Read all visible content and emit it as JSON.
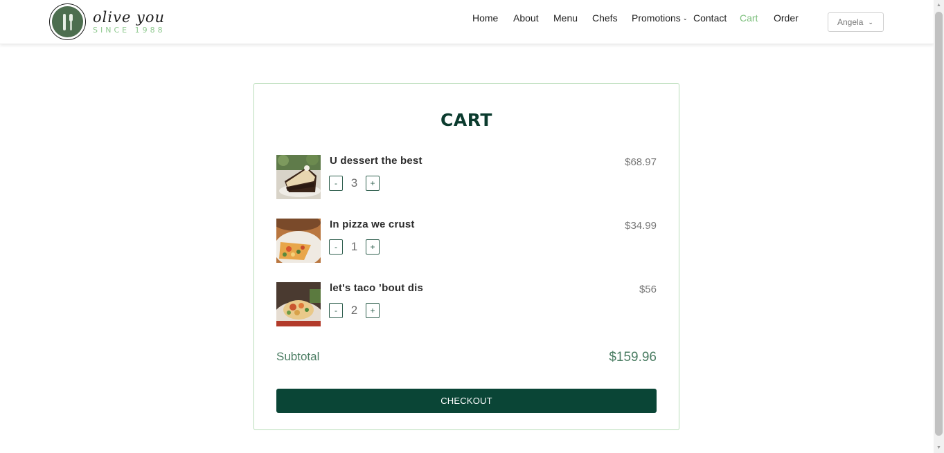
{
  "brand": {
    "name": "olive you",
    "tagline": "SINCE 1988",
    "logo_icon": "fork-knife-icon",
    "color": "#4d6e4f"
  },
  "nav": {
    "items": [
      {
        "label": "Home"
      },
      {
        "label": "About"
      },
      {
        "label": "Menu"
      },
      {
        "label": "Chefs"
      },
      {
        "label": "Promotions"
      },
      {
        "label": "Contact"
      },
      {
        "label": "Cart"
      },
      {
        "label": "Order"
      }
    ],
    "active": "Cart",
    "active_color": "#7cbf7c"
  },
  "user": {
    "name": "Angela"
  },
  "cart": {
    "title": "CART",
    "items": [
      {
        "name": "U dessert the best",
        "quantity": "3",
        "price": "$68.97",
        "image": "dessert-image"
      },
      {
        "name": "In pizza we crust",
        "quantity": "1",
        "price": "$34.99",
        "image": "pizza-image"
      },
      {
        "name": "let's taco ’bout dis",
        "quantity": "2",
        "price": "$56",
        "image": "taco-image"
      }
    ],
    "minus_label": "-",
    "plus_label": "+",
    "subtotal_label": "Subtotal",
    "subtotal_value": "$159.96",
    "checkout_label": "CHECKOUT",
    "accent_color": "#0a4536"
  }
}
